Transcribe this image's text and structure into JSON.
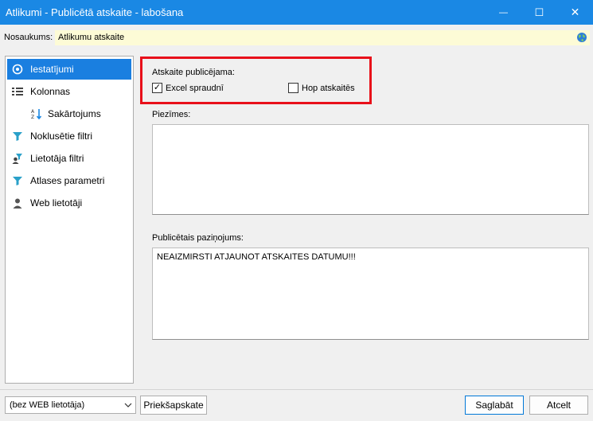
{
  "window": {
    "title": "Atlikumi - Publicētā atskaite - labošana",
    "minimize_glyph": "—",
    "maximize_glyph": "☐",
    "close_glyph": "✕"
  },
  "name_row": {
    "label": "Nosaukums:",
    "value": "Atlikumu atskaite",
    "icon": "globe-icon"
  },
  "sidebar": {
    "items": [
      {
        "label": "Iestatījumi",
        "icon": "settings-icon",
        "active": true
      },
      {
        "label": "Kolonnas",
        "icon": "columns-icon"
      },
      {
        "label": "Sakārtojums",
        "icon": "sort-icon"
      },
      {
        "label": "Noklusētie filtri",
        "icon": "default-filter-icon"
      },
      {
        "label": "Lietotāja filtri",
        "icon": "user-filter-icon"
      },
      {
        "label": "Atlases parametri",
        "icon": "filter-icon"
      },
      {
        "label": "Web lietotāji",
        "icon": "user-icon"
      }
    ]
  },
  "publish": {
    "label": "Atskaite publicējama:",
    "excel_label": "Excel spraudnī",
    "excel_checked": true,
    "hop_label": "Hop atskaitēs",
    "hop_checked": false,
    "check_glyph": "✓"
  },
  "notes": {
    "label": "Piezīmes:",
    "value": ""
  },
  "published_message": {
    "label": "Publicētais paziņojums:",
    "value": "NEAIZMIRSTI ATJAUNOT ATSKAITES DATUMU!!!"
  },
  "footer": {
    "web_user_select": "(bez WEB lietotāja)",
    "preview_button": "Priekšapskate",
    "save_button": "Saglabāt",
    "cancel_button": "Atcelt"
  },
  "colors": {
    "titlebar": "#1a88e4",
    "active_item": "#1a7fe0",
    "highlight_border": "#e8101a",
    "name_field_bg": "#fdfbd6"
  }
}
